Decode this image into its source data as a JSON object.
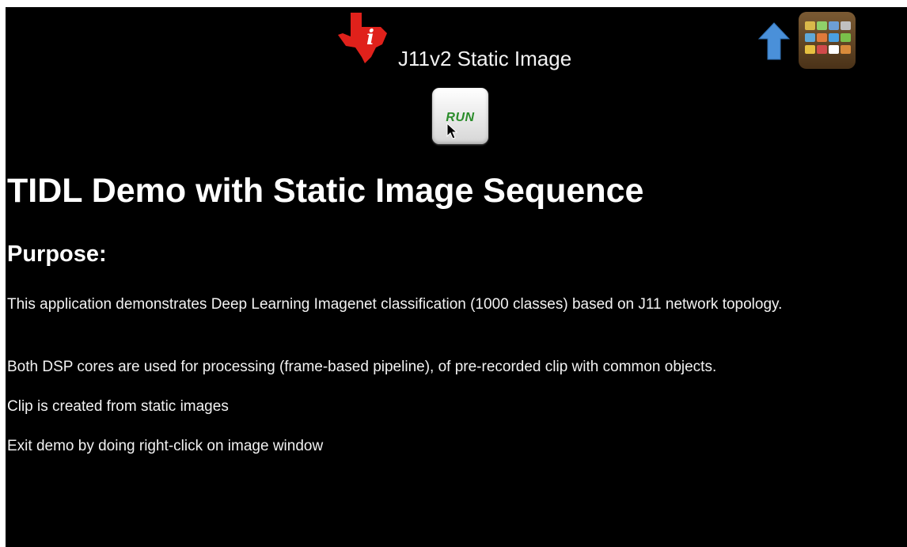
{
  "header": {
    "logo_icon": "texas-instruments-logo",
    "title": "J11v2 Static Image",
    "up_icon": "up-arrow-icon",
    "apps_icon": "apps-grid-icon"
  },
  "toolbar": {
    "run_label": "RUN",
    "run_color": "#2a8c2a"
  },
  "content": {
    "heading": "TIDL Demo with Static Image Sequence",
    "purpose_heading": "Purpose:",
    "paragraphs": [
      "This application demonstrates Deep Learning Imagenet classification (1000 classes) based on J11 network topology.",
      "Both DSP cores are used for processing (frame-based pipeline), of pre-recorded clip with common objects.",
      "Clip is created from static images",
      "Exit demo by doing right-click on image window"
    ]
  },
  "colors": {
    "background": "#000000",
    "text": "#ffffff",
    "logo_red": "#e0211b",
    "arrow_blue": "#4a90d9"
  }
}
